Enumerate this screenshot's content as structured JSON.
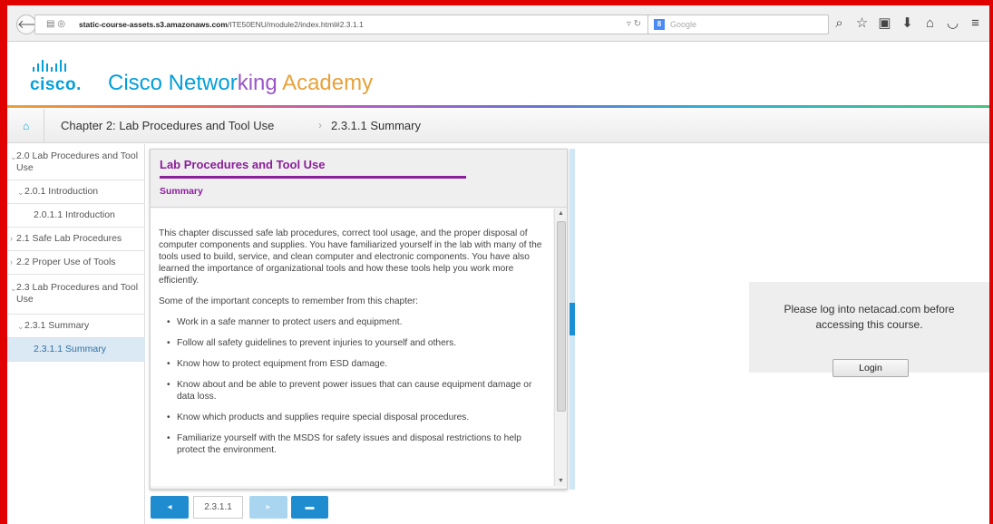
{
  "browser": {
    "url_host": "static-course-assets.s3.amazonaws.com",
    "url_path": "/ITE50ENU/module2/index.html#2.3.1.1",
    "search_placeholder": "Google",
    "icons": [
      "back-arrow-icon",
      "reload-icon",
      "search-icon",
      "bookmark-star-icon",
      "reading-list-icon",
      "download-icon",
      "home-icon",
      "pocket-icon",
      "menu-icon"
    ]
  },
  "brand": {
    "logo_word": "cisco.",
    "title_part1": "Cisco Networ",
    "title_part2": "king",
    "title_part3": " Academy",
    "accent_color": "#049fd9"
  },
  "breadcrumb": {
    "chapter": "Chapter 2: Lab Procedures and Tool Use",
    "separator": "›",
    "page": "2.3.1.1 Summary"
  },
  "sidebar": {
    "items": [
      {
        "label": "2.0 Lab Procedures and Tool Use",
        "chevron": "⌄",
        "level": 0
      },
      {
        "label": "2.0.1 Introduction",
        "chevron": "⌄",
        "level": 1
      },
      {
        "label": "2.0.1.1 Introduction",
        "chevron": "",
        "level": 2
      },
      {
        "label": "2.1 Safe Lab Procedures",
        "chevron": "›",
        "level": 0
      },
      {
        "label": "2.2 Proper Use of Tools",
        "chevron": "›",
        "level": 0
      },
      {
        "label": "2.3 Lab Procedures and Tool Use",
        "chevron": "⌄",
        "level": 0
      },
      {
        "label": "2.3.1 Summary",
        "chevron": "⌄",
        "level": 1
      },
      {
        "label": "2.3.1.1 Summary",
        "chevron": "",
        "level": 2,
        "active": true
      }
    ]
  },
  "content": {
    "title": "Lab Procedures and Tool Use",
    "subtitle": "Summary",
    "paragraph1": "This chapter discussed safe lab procedures, correct tool usage, and the proper disposal of computer components and supplies. You have familiarized yourself in the lab with many of the tools used to build, service, and clean computer and electronic components. You have also learned the importance of organizational tools and how these tools help you work more efficiently.",
    "paragraph2": "Some of the important concepts to remember from this chapter:",
    "bullets": [
      "Work in a safe manner to protect users and equipment.",
      "Follow all safety guidelines to prevent injuries to yourself and others.",
      "Know how to protect equipment from ESD damage.",
      "Know about and be able to prevent power issues that can cause equipment damage or data loss.",
      "Know which products and supplies require special disposal procedures.",
      "Familiarize yourself with the MSDS for safety issues and disposal restrictions to help protect the environment."
    ],
    "title_color": "#8b1e9b"
  },
  "pager": {
    "page_label": "2.3.1.1"
  },
  "login": {
    "message_line1": "Please log into netacad.com before",
    "message_line2": "accessing this course.",
    "button_label": "Login"
  }
}
